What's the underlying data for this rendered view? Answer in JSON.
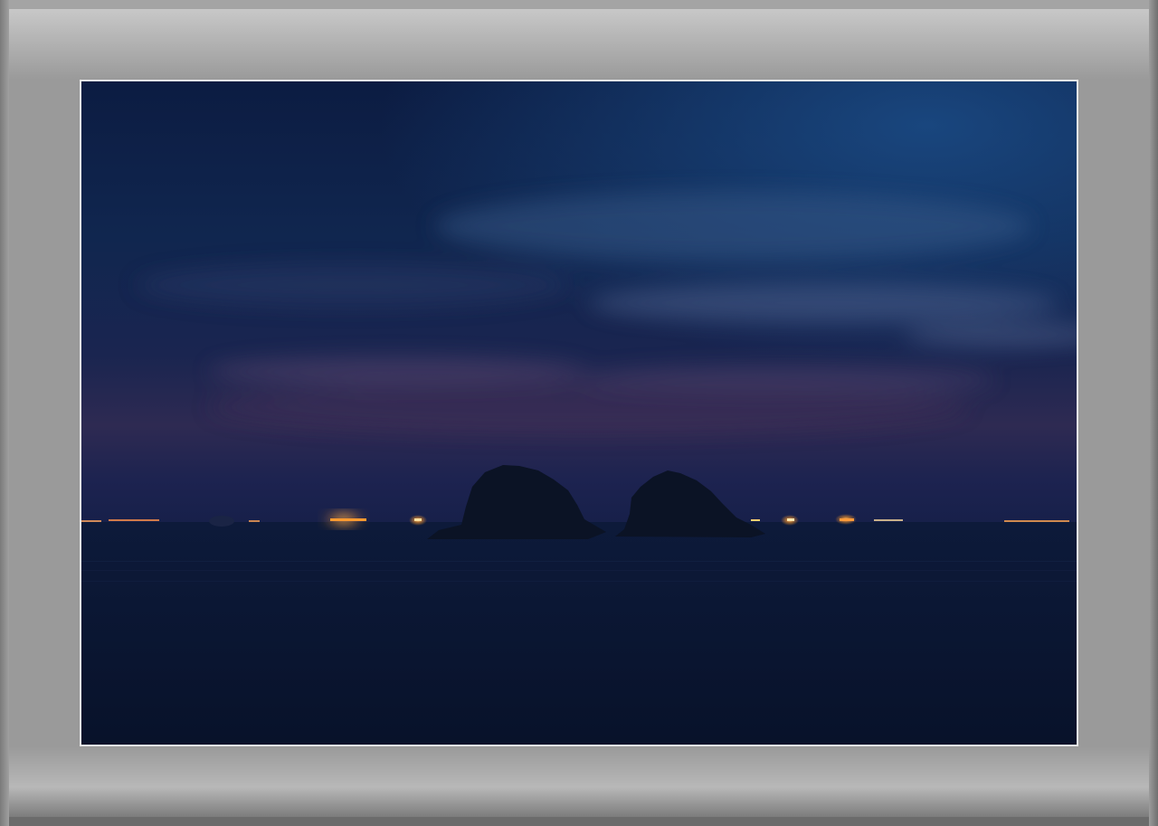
{
  "image": {
    "subject": "seascape",
    "colors": {
      "frame": "#9a9a9a",
      "border": "#e6e6e6",
      "sky_top": "#0d1f45",
      "sky_upper_right": "#16467f",
      "sky_horizon": "#3a2a4f",
      "sea": "#0a1530",
      "island": "#0c1424",
      "lights": "#ffb03a"
    }
  }
}
